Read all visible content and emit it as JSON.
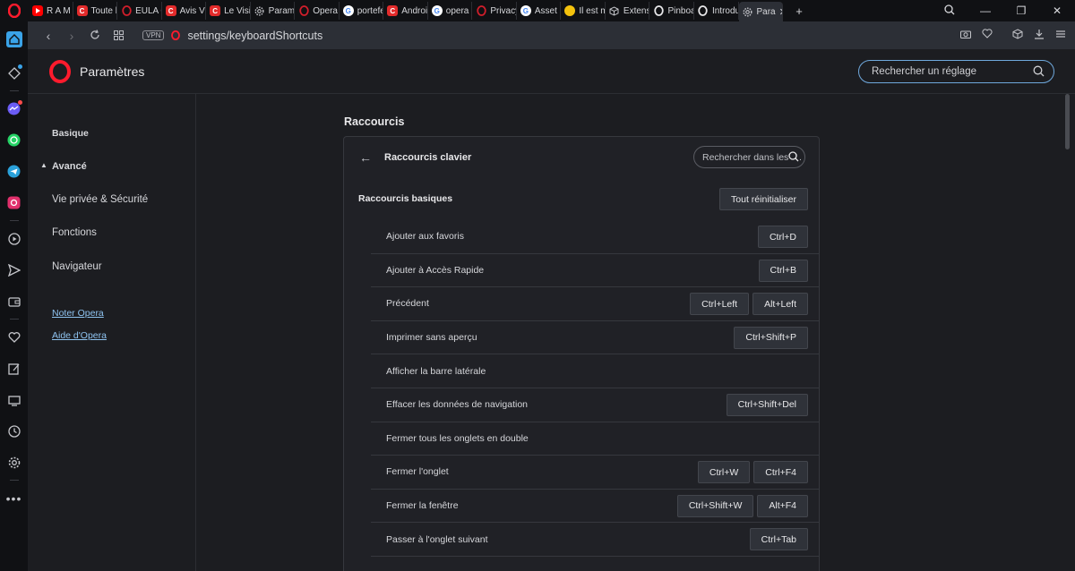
{
  "tabs": [
    {
      "label": "R A M ",
      "fav": "yt",
      "color": "#ff0000"
    },
    {
      "label": "Toute l",
      "fav": "C",
      "color": "#e32b2b"
    },
    {
      "label": "EULA O",
      "fav": "O",
      "color": "#d21e2b"
    },
    {
      "label": "Avis Vi",
      "fav": "C",
      "color": "#e32b2b"
    },
    {
      "label": "Le Visit",
      "fav": "C",
      "color": "#e32b2b"
    },
    {
      "label": "Paramè",
      "fav": "gear",
      "color": "#9a9ba0"
    },
    {
      "label": "Opera ",
      "fav": "O",
      "color": "#d21e2b"
    },
    {
      "label": "portefe",
      "fav": "G",
      "color": "#4285f4"
    },
    {
      "label": "Androi",
      "fav": "C",
      "color": "#e32b2b"
    },
    {
      "label": "opera o",
      "fav": "G",
      "color": "#4285f4"
    },
    {
      "label": "Privacy",
      "fav": "O",
      "color": "#d21e2b"
    },
    {
      "label": "Asset -",
      "fav": "G",
      "color": "#4285f4"
    },
    {
      "label": "Il est m",
      "fav": "emoji",
      "color": "#f4c20d"
    },
    {
      "label": "Extensi",
      "fav": "cube",
      "color": "#9a9ba0"
    },
    {
      "label": "Pinboa",
      "fav": "O",
      "color": "#e8e8ea"
    },
    {
      "label": "Introdu",
      "fav": "O",
      "color": "#e8e8ea"
    },
    {
      "label": "Para",
      "fav": "gear",
      "color": "#9a9ba0",
      "active": true
    }
  ],
  "address": {
    "vpn": "VPN",
    "url": "settings/keyboardShortcuts"
  },
  "header": {
    "title": "Paramètres",
    "search_placeholder": "Rechercher un réglage"
  },
  "leftnav": {
    "basic": "Basique",
    "advanced": "Avancé",
    "privacy": "Vie privée & Sécurité",
    "features": "Fonctions",
    "browser": "Navigateur",
    "rate": "Noter Opera",
    "help": "Aide d'Opera"
  },
  "content": {
    "section_title": "Raccourcis",
    "card_title": "Raccourcis clavier",
    "search_placeholder": "Rechercher dans les r...",
    "basic_title": "Raccourcis basiques",
    "reset_label": "Tout réinitialiser",
    "shortcuts": [
      {
        "label": "Ajouter aux favoris",
        "keys": [
          "Ctrl+D"
        ]
      },
      {
        "label": "Ajouter à Accès Rapide",
        "keys": [
          "Ctrl+B"
        ]
      },
      {
        "label": "Précédent",
        "keys": [
          "Ctrl+Left",
          "Alt+Left"
        ]
      },
      {
        "label": "Imprimer sans aperçu",
        "keys": [
          "Ctrl+Shift+P"
        ]
      },
      {
        "label": "Afficher la barre latérale",
        "keys": []
      },
      {
        "label": "Effacer les données de navigation",
        "keys": [
          "Ctrl+Shift+Del"
        ]
      },
      {
        "label": "Fermer tous les onglets en double",
        "keys": []
      },
      {
        "label": "Fermer l'onglet",
        "keys": [
          "Ctrl+W",
          "Ctrl+F4"
        ]
      },
      {
        "label": "Fermer la fenêtre",
        "keys": [
          "Ctrl+Shift+W",
          "Alt+F4"
        ]
      },
      {
        "label": "Passer à l'onglet suivant",
        "keys": [
          "Ctrl+Tab"
        ]
      }
    ]
  }
}
